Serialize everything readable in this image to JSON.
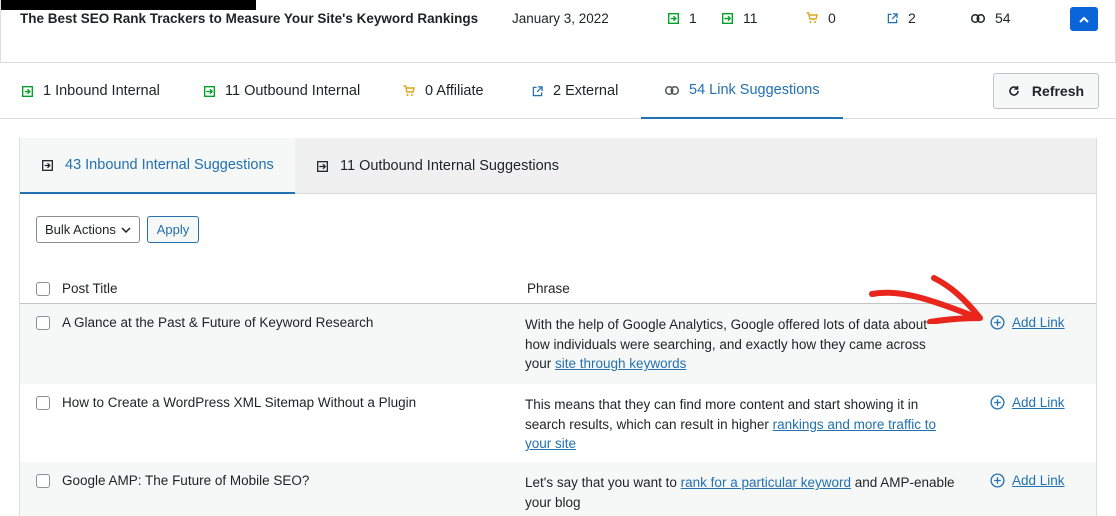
{
  "header": {
    "post_title": "The Best SEO Rank Trackers to Measure Your Site's Keyword Rankings",
    "date": "January 3, 2022",
    "stats": {
      "inbound": "1",
      "outbound": "11",
      "affiliate": "0",
      "external": "2",
      "suggestions": "54"
    }
  },
  "tabs": {
    "inbound": "1 Inbound Internal",
    "outbound": "11 Outbound Internal",
    "affiliate": "0 Affiliate",
    "external": "2 External",
    "suggestions": "54 Link Suggestions",
    "refresh": "Refresh"
  },
  "subtabs": {
    "inbound": "43 Inbound Internal Suggestions",
    "outbound": "11 Outbound Internal Suggestions"
  },
  "bulk": {
    "select_value": "Bulk Actions",
    "apply": "Apply"
  },
  "table": {
    "col_title": "Post Title",
    "col_phrase": "Phrase",
    "add_link": "Add Link",
    "rows": [
      {
        "title": "A Glance at the Past & Future of Keyword Research",
        "phrase_before": "With the help of Google Analytics, Google offered lots of data about how individuals were searching, and exactly how they came across your ",
        "phrase_link": "site through keywords",
        "phrase_after": ""
      },
      {
        "title": "How to Create a WordPress XML Sitemap Without a Plugin",
        "phrase_before": "This means that they can find more content and start showing it in search results, which can result in higher ",
        "phrase_link": "rankings and more traffic to your site",
        "phrase_after": ""
      },
      {
        "title": "Google AMP: The Future of Mobile SEO?",
        "phrase_before": "Let's say that you want to ",
        "phrase_link": "rank for a particular keyword",
        "phrase_after": " and AMP-enable your blog"
      }
    ]
  },
  "colors": {
    "accent": "#2271b1",
    "green": "#00a32a",
    "orange": "#dba617",
    "annotation_red": "#e8261c"
  }
}
